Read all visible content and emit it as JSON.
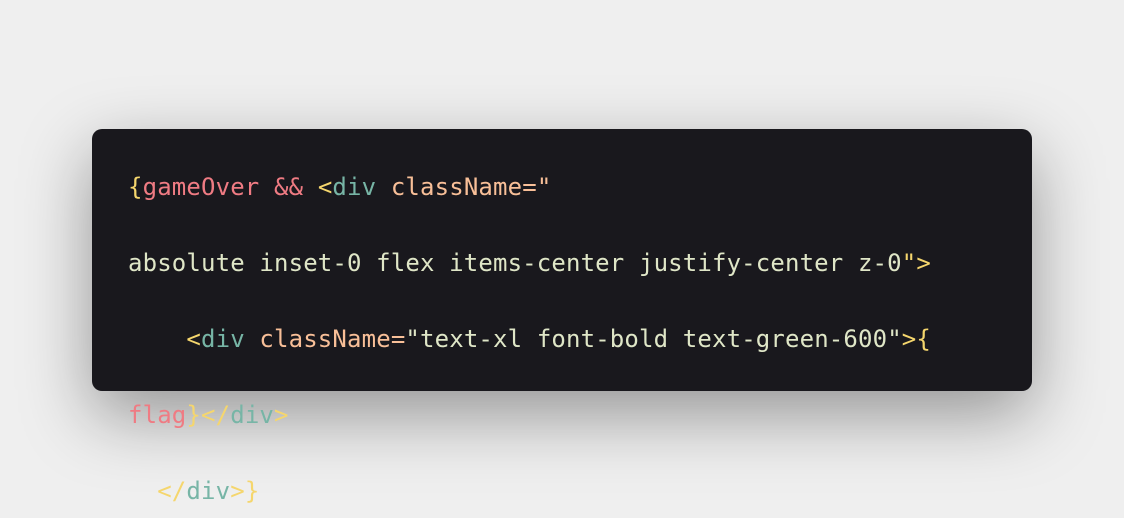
{
  "colors": {
    "background": "#efefef",
    "card": "#19181d",
    "punctuation": "#f5d66d",
    "identifier": "#ef7b83",
    "operator": "#ef7b83",
    "tag": "#77b5a6",
    "attribute": "#f8bf98",
    "string": "#dfe6c7"
  },
  "code": {
    "lines": [
      [
        {
          "text": "{",
          "type": "punctuation"
        },
        {
          "text": "gameOver",
          "type": "identifier"
        },
        {
          "text": " && ",
          "type": "operator"
        },
        {
          "text": "<",
          "type": "punctuation"
        },
        {
          "text": "div",
          "type": "tag"
        },
        {
          "text": " className",
          "type": "attribute"
        },
        {
          "text": "=\"",
          "type": "attribute"
        }
      ],
      [
        {
          "text": "absolute inset-0 flex items-center justify-center z-0",
          "type": "string"
        },
        {
          "text": "\">",
          "type": "punctuation"
        }
      ],
      [
        {
          "text": "    <",
          "type": "punctuation"
        },
        {
          "text": "div",
          "type": "tag"
        },
        {
          "text": " className",
          "type": "attribute"
        },
        {
          "text": "=",
          "type": "attribute"
        },
        {
          "text": "\"text-xl font-bold text-green-600\"",
          "type": "string"
        },
        {
          "text": ">{",
          "type": "punctuation"
        }
      ],
      [
        {
          "text": "flag",
          "type": "identifier"
        },
        {
          "text": "}</",
          "type": "punctuation"
        },
        {
          "text": "div",
          "type": "tag"
        },
        {
          "text": ">",
          "type": "punctuation"
        }
      ],
      [
        {
          "text": "  </",
          "type": "punctuation"
        },
        {
          "text": "div",
          "type": "tag"
        },
        {
          "text": ">}",
          "type": "punctuation"
        }
      ]
    ]
  }
}
